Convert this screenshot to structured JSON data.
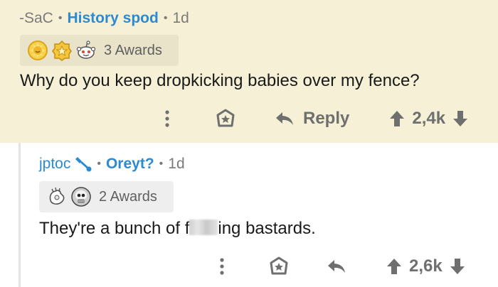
{
  "comment_main": {
    "author": "-SaC",
    "flair": "History spod",
    "age": "1d",
    "awards_label": "3 Awards",
    "awards": [
      "sun-award-icon",
      "gold-star-award-icon",
      "reddit-snoo-award-icon"
    ],
    "body": "Why do you keep dropkicking babies over my fence?",
    "actions": {
      "more_icon": "vertical-dots-icon",
      "award_icon": "gift-star-icon",
      "reply_label": "Reply",
      "score": "2,4k"
    },
    "highlight_color": "#f6f1d6"
  },
  "comment_reply": {
    "author": "jptoc",
    "flair": "Oreyt?",
    "age": "1d",
    "awards_label": "2 Awards",
    "awards": [
      "hand-award-icon",
      "skull-award-icon"
    ],
    "body_before": "They're a bunch of f",
    "body_after": "ing bastards.",
    "actions": {
      "more_icon": "vertical-dots-icon",
      "award_icon": "gift-star-icon",
      "reply_icon": "reply-arrow-icon",
      "score": "2,6k"
    }
  },
  "colors": {
    "link_blue": "#2c8ad0",
    "muted_text": "#7a7a7a",
    "icon_gray": "#6f6f6f"
  }
}
